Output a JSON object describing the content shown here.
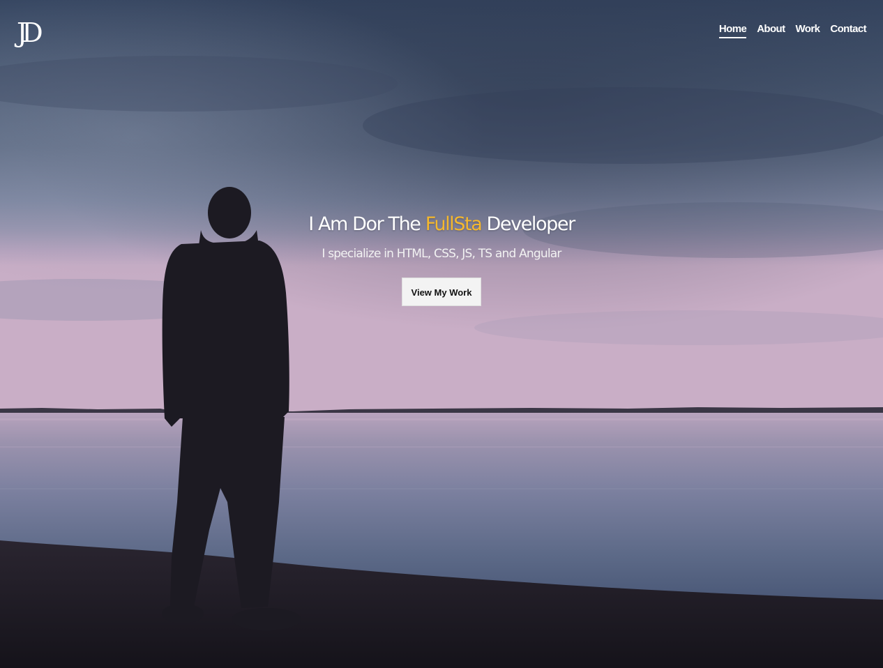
{
  "brand": {
    "logo_text": "JD"
  },
  "nav": {
    "items": [
      {
        "label": "Home",
        "active": true
      },
      {
        "label": "About",
        "active": false
      },
      {
        "label": "Work",
        "active": false
      },
      {
        "label": "Contact",
        "active": false
      }
    ]
  },
  "hero": {
    "headline_prefix": "I Am Dor The ",
    "headline_accent": "FullSta",
    "headline_suffix": " Developer",
    "subline": "I specialize in HTML, CSS, JS, TS and Angular",
    "cta_label": "View My Work",
    "accent_color": "#f5b82e"
  }
}
